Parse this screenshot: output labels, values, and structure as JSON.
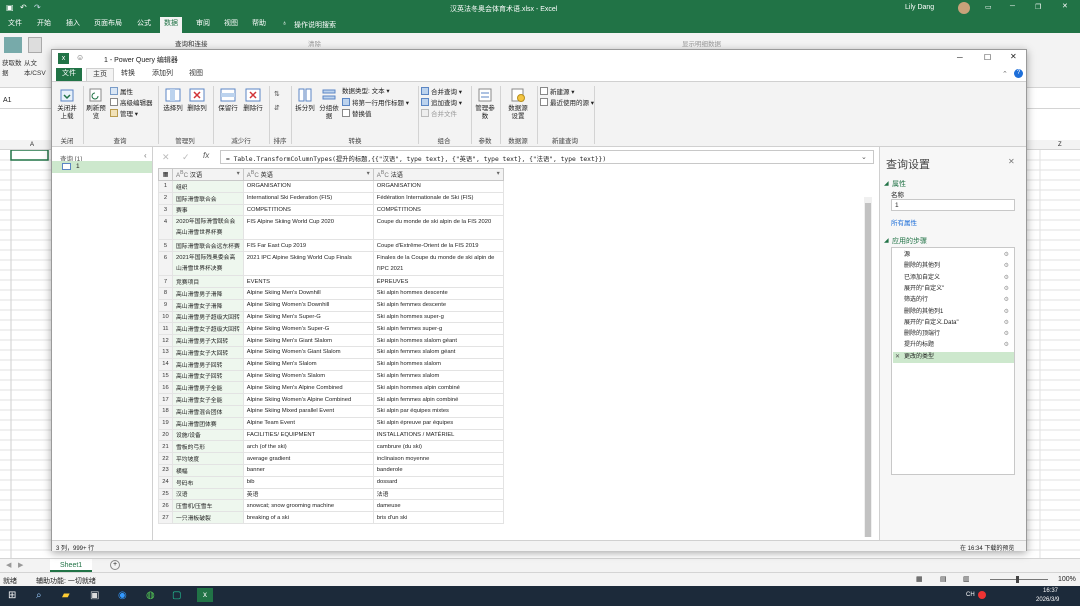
{
  "excel": {
    "title": "汉英法冬奥会体育术语.xlsx - Excel",
    "user": "Lily Dang",
    "share": "共享",
    "tabs": [
      "文件",
      "开始",
      "插入",
      "页面布局",
      "公式",
      "数据",
      "审阅",
      "视图",
      "帮助"
    ],
    "active_tab": "数据",
    "tell_me": "操作说明搜索",
    "ribbon": {
      "get_data": "获取数据",
      "from_csv": "从文本/CSV",
      "queries_connections": "查询和连接",
      "clear": "清除",
      "show_detail": "显示明细数据"
    },
    "name_box": "A1",
    "col_a": "A",
    "col_z": "Z",
    "sheet_tab": "Sheet1",
    "status": {
      "ready": "就绪",
      "accessibility": "辅助功能: 一切就绪",
      "zoom": "100%"
    },
    "taskbar": {
      "lang": "CH",
      "time": "16:37",
      "date": "2026/3/9"
    }
  },
  "pq": {
    "title": "1 - Power Query 编辑器",
    "tabs": [
      "文件",
      "主页",
      "转换",
      "添加列",
      "视图"
    ],
    "active_tab": "主页",
    "ribbon": {
      "close_load": "关闭并上载",
      "refresh": "刷新预览",
      "properties": "属性",
      "adv_editor": "高级编辑器",
      "manage": "管理",
      "choose_cols": "选择列",
      "remove_cols": "删除列",
      "keep_rows": "保留行",
      "remove_rows": "删除行",
      "split_col": "拆分列",
      "group_by": "分组依据",
      "data_type": "数据类型: 文本",
      "first_row_header": "将第一行用作标题",
      "replace_values": "替换值",
      "merge_queries": "合并查询",
      "append_queries": "追加查询",
      "combine_files": "合并文件",
      "manage_params": "管理参数",
      "data_source_settings": "数据源设置",
      "new_source": "新建源",
      "recent_sources": "最近使用的源"
    },
    "groups": [
      "关闭",
      "查询",
      "管理列",
      "减少行",
      "排序",
      "转换",
      "组合",
      "参数",
      "数据源",
      "新建查询"
    ],
    "queries_header": "查询 [1]",
    "query_name": "1",
    "formula": "= Table.TransformColumnTypes(提升的标题,{{\"汉语\", type text}, {\"英语\", type text}, {\"法语\", type text}})",
    "columns": [
      "汉语",
      "英语",
      "法语"
    ],
    "rows": [
      [
        "组织",
        "ORGANISATION",
        "ORGANISATION"
      ],
      [
        "国际滑雪联合会",
        "International Ski Federation (FIS)",
        "Fédération Internationale de Ski (FIS)"
      ],
      [
        "赛事",
        "COMPETITIONS",
        "COMPÉTITIONS"
      ],
      [
        "2020年国际滑雪联合会高山滑雪世界杯赛",
        "FIS Alpine Skiing World Cup 2020",
        "Coupe du monde de ski alpin de la FIS 2020"
      ],
      [
        "国际滑雪联合会远东杯赛",
        "FIS Far East Cup 2019",
        "Coupe d'Extrême-Orient de la FIS 2019"
      ],
      [
        "2021年国际残奥委会高山滑雪世界杯决赛",
        "2021 IPC Alpine Skiing World Cup Finals",
        "Finales de la Coupe du monde de ski alpin de l'IPC 2021"
      ],
      [
        "竞赛项目",
        "EVENTS",
        "ÉPREUVES"
      ],
      [
        "高山滑雪男子滑降",
        "Alpine Skiing Men's Downhill",
        "Ski alpin hommes descente"
      ],
      [
        "高山滑雪女子滑降",
        "Alpine Skiing Women's Downhill",
        "Ski alpin femmes descente"
      ],
      [
        "高山滑雪男子超级大回转",
        "Alpine Skiing Men's Super-G",
        "Ski alpin hommes super-g"
      ],
      [
        "高山滑雪女子超级大回转",
        "Alpine Skiing Women's Super-G",
        "Ski alpin femmes super-g"
      ],
      [
        "高山滑雪男子大回转",
        "Alpine Skiing Men's Giant Slalom",
        "Ski alpin hommes slalom géant"
      ],
      [
        "高山滑雪女子大回转",
        "Alpine Skiing Women's Giant Slalom",
        "Ski alpin femmes slalom géant"
      ],
      [
        "高山滑雪男子回转",
        "Alpine Skiing Men's Slalom",
        "Ski alpin hommes slalom"
      ],
      [
        "高山滑雪女子回转",
        "Alpine Skiing Women's Slalom",
        "Ski alpin femmes slalom"
      ],
      [
        "高山滑雪男子全能",
        "Alpine Skiing Men's Alpine Combined",
        "Ski alpin hommes alpin combiné"
      ],
      [
        "高山滑雪女子全能",
        "Alpine Skiing Women's Alpine Combined",
        "Ski alpin femmes alpin combiné"
      ],
      [
        "高山滑雪混合团体",
        "Alpine Skiing Mixed parallel Event",
        "Ski alpin par équipes mixtes"
      ],
      [
        "高山滑雪团体赛",
        "Alpine Team Event",
        "Ski alpin épreuve par équipes"
      ],
      [
        "设施/设备",
        "FACILITIES/ EQUIPMENT",
        "INSTALLATIONS / MATÉRIEL"
      ],
      [
        "雪板的弓形",
        "arch (of the ski)",
        "cambrure (du ski)"
      ],
      [
        "平均坡度",
        "average gradient",
        "inclinaison moyenne"
      ],
      [
        "横幅",
        "banner",
        "banderole"
      ],
      [
        "号码布",
        "bib",
        "dossard"
      ],
      [
        "汉语",
        "英语",
        "法语"
      ],
      [
        "压雪机/压雪车",
        "snowcat; snow grooming machine",
        "dameuse"
      ],
      [
        "一只滑板破裂",
        "breaking of a ski",
        "bris d'un ski"
      ]
    ],
    "settings": {
      "title": "查询设置",
      "props_title": "属性",
      "name_label": "名称",
      "name_value": "1",
      "all_props": "所有属性",
      "steps_title": "应用的步骤",
      "steps": [
        "源",
        "删除的其他列",
        "已添加自定义",
        "展开的\"自定义\"",
        "筛选的行",
        "删除的其他列1",
        "展开的\"自定义.Data\"",
        "删除的顶端行",
        "提升的标题",
        "更改的类型"
      ],
      "active_step": "更改的类型"
    },
    "status": {
      "left": "3 列，999+ 行",
      "right": "在 16:34 下载的预览"
    }
  }
}
